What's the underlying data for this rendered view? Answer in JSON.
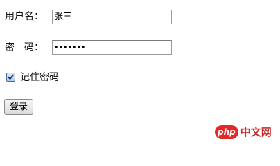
{
  "form": {
    "username_label": "用户名：",
    "username_value": "张三",
    "password_label": "密　码：",
    "password_value": "•••••••",
    "remember_checked": true,
    "remember_label": "记住密码",
    "submit_label": "登录"
  },
  "watermark": {
    "brand": "php",
    "site_name": "中文网"
  },
  "colors": {
    "checkbox_accent": "#3c6fa8",
    "logo_red": "#e02a2a"
  }
}
